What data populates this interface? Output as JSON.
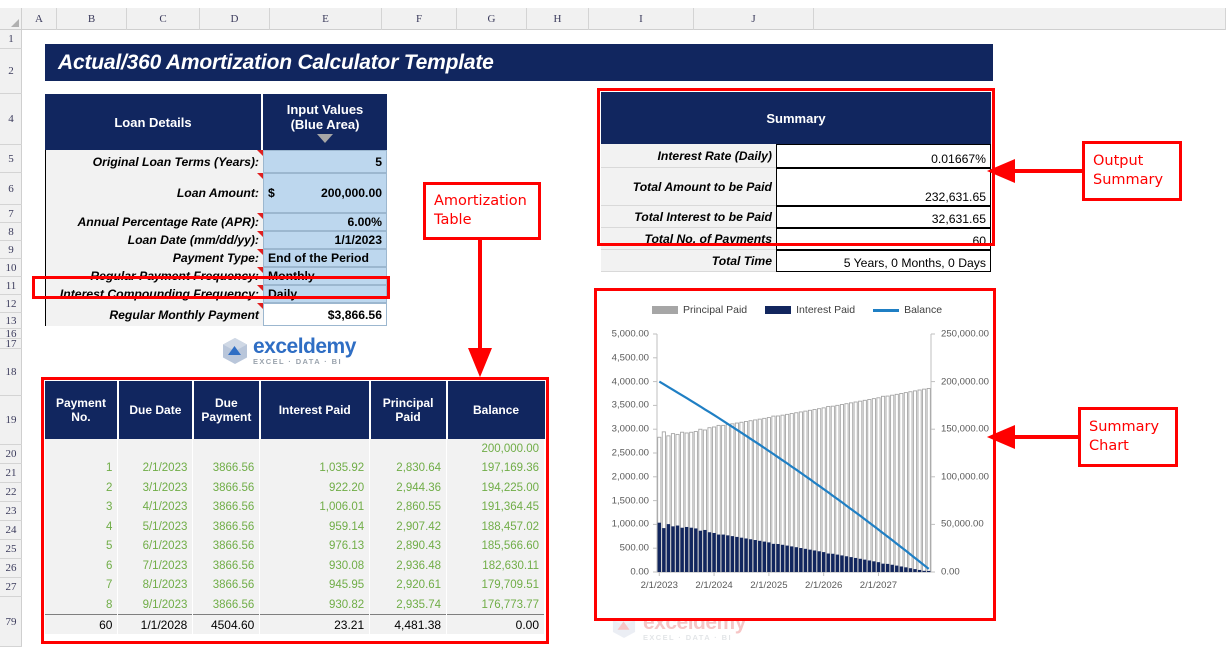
{
  "spreadsheet": {
    "columns": [
      "A",
      "B",
      "C",
      "D",
      "E",
      "F",
      "G",
      "H",
      "I",
      "J"
    ],
    "rows": [
      "1",
      "2",
      "4",
      "5",
      "6",
      "7",
      "8",
      "9",
      "10",
      "11",
      "12",
      "13",
      "16",
      "17",
      "18",
      "19",
      "20",
      "21",
      "22",
      "23",
      "24",
      "25",
      "26",
      "27",
      "79"
    ]
  },
  "title": "Actual/360 Amortization Calculator Template",
  "loan_details": {
    "header_left": "Loan Details",
    "header_right_line1": "Input Values",
    "header_right_line2": "(Blue Area)",
    "dropdown_icon": "triangle-down-icon",
    "rows": [
      {
        "label": "Original Loan Terms (Years):",
        "value": "5",
        "type": "num"
      },
      {
        "label": "Loan Amount:",
        "value": "200,000.00",
        "prefix": "$",
        "type": "money"
      },
      {
        "label": "Annual Percentage Rate (APR):",
        "value": "6.00%",
        "type": "num"
      },
      {
        "label": "Loan Date (mm/dd/yy):",
        "value": "1/1/2023",
        "type": "num"
      },
      {
        "label": "Payment Type:",
        "value": "End of the Period",
        "type": "txt"
      },
      {
        "label": "Regular Payment Frequency:",
        "value": "Monthly",
        "type": "txt"
      },
      {
        "label": "Interest Compounding Frequency:",
        "value": "Daily",
        "type": "txt"
      },
      {
        "label": "Regular Monthly Payment",
        "value": "$3,866.56",
        "type": "num",
        "white": true
      }
    ]
  },
  "logo": {
    "name": "exceldemy",
    "tagline": "EXCEL · DATA · BI"
  },
  "amortization": {
    "columns": [
      "Payment No.",
      "Due Date",
      "Due Payment",
      "Interest Paid",
      "Principal Paid",
      "Balance"
    ],
    "rows": [
      [
        "",
        "",
        "",
        "",
        "",
        "200,000.00"
      ],
      [
        "1",
        "2/1/2023",
        "3866.56",
        "1,035.92",
        "2,830.64",
        "197,169.36"
      ],
      [
        "2",
        "3/1/2023",
        "3866.56",
        "922.20",
        "2,944.36",
        "194,225.00"
      ],
      [
        "3",
        "4/1/2023",
        "3866.56",
        "1,006.01",
        "2,860.55",
        "191,364.45"
      ],
      [
        "4",
        "5/1/2023",
        "3866.56",
        "959.14",
        "2,907.42",
        "188,457.02"
      ],
      [
        "5",
        "6/1/2023",
        "3866.56",
        "976.13",
        "2,890.43",
        "185,566.60"
      ],
      [
        "6",
        "7/1/2023",
        "3866.56",
        "930.08",
        "2,936.48",
        "182,630.11"
      ],
      [
        "7",
        "8/1/2023",
        "3866.56",
        "945.95",
        "2,920.61",
        "179,709.51"
      ],
      [
        "8",
        "9/1/2023",
        "3866.56",
        "930.82",
        "2,935.74",
        "176,773.77"
      ]
    ],
    "last_row": [
      "60",
      "1/1/2028",
      "4504.60",
      "23.21",
      "4,481.38",
      "0.00"
    ]
  },
  "summary": {
    "header": "Summary",
    "rows": [
      {
        "label": "Interest Rate (Daily)",
        "value": "0.01667%"
      },
      {
        "label": "Total Amount to be Paid",
        "value": "232,631.65"
      },
      {
        "label": "Total Interest to be Paid",
        "value": "32,631.65"
      },
      {
        "label": "Total No. of Payments",
        "value": "60"
      },
      {
        "label": "Total Time",
        "value": "5 Years, 0 Months, 0 Days"
      }
    ]
  },
  "chart_data": {
    "type": "bar",
    "title": "",
    "legend": [
      {
        "name": "Principal Paid",
        "color": "#a6a6a6",
        "marker": "swatch"
      },
      {
        "name": "Interest Paid",
        "color": "#12265e",
        "marker": "swatch"
      },
      {
        "name": "Balance",
        "color": "#1f7fc4",
        "marker": "line"
      }
    ],
    "legend_position": "top",
    "grid": false,
    "xlabel": "",
    "x_tick_labels": [
      "2/1/2023",
      "2/1/2024",
      "2/1/2025",
      "2/1/2026",
      "2/1/2027"
    ],
    "left_axis": {
      "label": "",
      "ylim": [
        0,
        5000
      ],
      "ticks": [
        "0.00",
        "500.00",
        "1,000.00",
        "1,500.00",
        "2,000.00",
        "2,500.00",
        "3,000.00",
        "3,500.00",
        "4,000.00",
        "4,500.00",
        "5,000.00"
      ]
    },
    "right_axis": {
      "label": "",
      "ylim": [
        0,
        250000
      ],
      "ticks": [
        "0.00",
        "50,000.00",
        "100,000.00",
        "150,000.00",
        "200,000.00",
        "250,000.00"
      ]
    },
    "categories": [
      "2/1/2023",
      "3/1/2023",
      "4/1/2023",
      "5/1/2023",
      "6/1/2023",
      "7/1/2023",
      "8/1/2023",
      "9/1/2023",
      "10/1/2023",
      "11/1/2023",
      "12/1/2023",
      "1/1/2024",
      "2/1/2024",
      "3/1/2024",
      "4/1/2024",
      "5/1/2024",
      "6/1/2024",
      "7/1/2024",
      "8/1/2024",
      "9/1/2024",
      "10/1/2024",
      "11/1/2024",
      "12/1/2024",
      "1/1/2025",
      "2/1/2025",
      "3/1/2025",
      "4/1/2025",
      "5/1/2025",
      "6/1/2025",
      "7/1/2025",
      "8/1/2025",
      "9/1/2025",
      "10/1/2025",
      "11/1/2025",
      "12/1/2025",
      "1/1/2026",
      "2/1/2026",
      "3/1/2026",
      "4/1/2026",
      "5/1/2026",
      "6/1/2026",
      "7/1/2026",
      "8/1/2026",
      "9/1/2026",
      "10/1/2026",
      "11/1/2026",
      "12/1/2026",
      "1/1/2027",
      "2/1/2027",
      "3/1/2027",
      "4/1/2027",
      "5/1/2027",
      "6/1/2027",
      "7/1/2027",
      "8/1/2027",
      "9/1/2027",
      "10/1/2027",
      "11/1/2027",
      "12/1/2027",
      "1/1/2028"
    ],
    "series": [
      {
        "name": "Principal Paid",
        "axis": "left",
        "color": "#a6a6a6",
        "values": [
          2830.64,
          2944.36,
          2860.55,
          2907.42,
          2890.43,
          2936.48,
          2920.61,
          2935.74,
          2951.13,
          2999.09,
          2983.3,
          3031.39,
          3046.78,
          3079.94,
          3080.3,
          3096.66,
          3112.83,
          3129.36,
          3145.59,
          3162.08,
          3178.38,
          3194.95,
          3211.32,
          3228.0,
          3244.47,
          3275.12,
          3277.86,
          3294.82,
          3311.6,
          3328.67,
          3345.54,
          3362.7,
          3379.66,
          3396.91,
          3413.96,
          3431.3,
          3448.44,
          3478.27,
          3483.45,
          3501.04,
          3518.43,
          3536.11,
          3553.58,
          3571.35,
          3588.91,
          3606.77,
          3624.42,
          3642.37,
          3660.11,
          3691.27,
          3696.2,
          3714.36,
          3732.31,
          3750.56,
          3768.6,
          3786.94,
          3805.07,
          3823.5,
          3841.72,
          3856.0
        ]
      },
      {
        "name": "Interest Paid",
        "axis": "left",
        "color": "#12265e",
        "values": [
          1035.92,
          922.2,
          1006.01,
          959.14,
          976.13,
          930.08,
          945.95,
          930.82,
          915.43,
          867.47,
          883.26,
          835.17,
          819.78,
          786.62,
          786.26,
          769.9,
          753.73,
          737.2,
          720.97,
          704.48,
          688.18,
          671.61,
          655.24,
          638.56,
          622.09,
          591.44,
          588.7,
          571.74,
          554.96,
          537.89,
          521.02,
          503.86,
          486.9,
          469.65,
          452.6,
          435.26,
          418.12,
          388.29,
          383.11,
          365.52,
          348.13,
          330.45,
          312.98,
          295.21,
          277.65,
          259.79,
          242.14,
          224.19,
          206.45,
          175.29,
          170.36,
          152.2,
          134.25,
          116.0,
          97.96,
          79.62,
          61.49,
          43.06,
          24.84,
          23.21
        ]
      },
      {
        "name": "Balance",
        "axis": "right",
        "color": "#1f7fc4",
        "values": [
          200000.0,
          197169.36,
          194225.0,
          191364.45,
          188457.02,
          185566.6,
          182630.11,
          179709.51,
          176773.77,
          173822.64,
          170823.55,
          167840.25,
          164808.86,
          161762.08,
          158682.14,
          155601.84,
          152505.18,
          149392.35,
          146262.99,
          143117.4,
          139955.32,
          136776.94,
          133581.99,
          130370.67,
          127142.67,
          123898.2,
          120623.08,
          117345.22,
          114050.4,
          110738.8,
          107410.13,
          104064.59,
          100701.89,
          97322.23,
          93925.32,
          90511.36,
          87080.06,
          83631.62,
          80153.35,
          76669.9,
          73168.86,
          69650.43,
          66114.32,
          62560.74,
          58989.39,
          55400.48,
          51793.71,
          48169.29,
          44526.92,
          40866.81,
          37175.54,
          33479.34,
          29764.98,
          26032.67,
          22282.11,
          18513.51,
          14726.57,
          10921.5,
          7098.0,
          3256.28
        ]
      }
    ]
  },
  "annotations": [
    {
      "id": "amortization-table",
      "line1": "Amortization",
      "line2": "Table"
    },
    {
      "id": "output-summary",
      "line1": "Output",
      "line2": "Summary"
    },
    {
      "id": "summary-chart",
      "line1": "Summary",
      "line2": "Chart"
    }
  ]
}
